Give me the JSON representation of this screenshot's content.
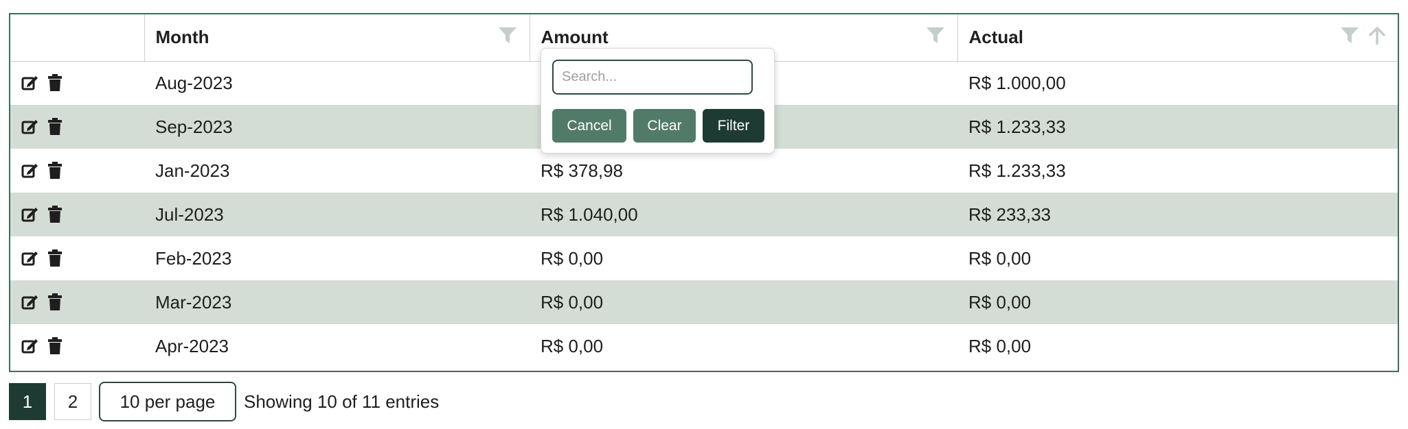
{
  "table": {
    "columns": {
      "month": "Month",
      "amount": "Amount",
      "actual": "Actual"
    },
    "rows": [
      {
        "month": "Aug-2023",
        "amount": "",
        "actual": "R$ 1.000,00"
      },
      {
        "month": "Sep-2023",
        "amount": "",
        "actual": "R$ 1.233,33"
      },
      {
        "month": "Jan-2023",
        "amount": "R$ 378,98",
        "actual": "R$ 1.233,33"
      },
      {
        "month": "Jul-2023",
        "amount": "R$ 1.040,00",
        "actual": "R$ 233,33"
      },
      {
        "month": "Feb-2023",
        "amount": "R$ 0,00",
        "actual": "R$ 0,00"
      },
      {
        "month": "Mar-2023",
        "amount": "R$ 0,00",
        "actual": "R$ 0,00"
      },
      {
        "month": "Apr-2023",
        "amount": "R$ 0,00",
        "actual": "R$ 0,00"
      }
    ]
  },
  "filter_popover": {
    "search_placeholder": "Search...",
    "cancel_label": "Cancel",
    "clear_label": "Clear",
    "filter_label": "Filter"
  },
  "pagination": {
    "pages": [
      "1",
      "2"
    ],
    "per_page_label": "10 per page",
    "entries_text": "Showing 10 of 11 entries"
  },
  "colors": {
    "accent_dark": "#1e3b33",
    "accent": "#527a69",
    "row_alt": "#d4ddd5",
    "filter_icon": "#c3cfc7"
  },
  "icons": {
    "column_filter": "filter-icon",
    "sort": "arrow-up-icon",
    "row_edit": "edit-icon",
    "row_delete": "trash-icon"
  }
}
